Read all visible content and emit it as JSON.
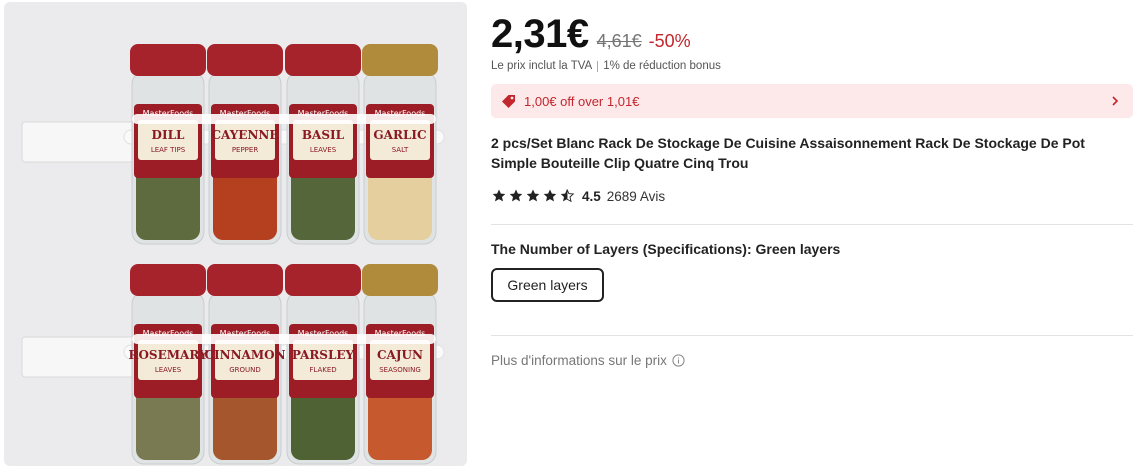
{
  "product_image": {
    "jars": [
      {
        "label_line1": "DILL",
        "label_line2": "LEAF TIPS",
        "cap": "#a6232c"
      },
      {
        "label_line1": "CAYENNE",
        "label_line2": "PEPPER",
        "cap": "#a6232c"
      },
      {
        "label_line1": "BASIL",
        "label_line2": "LEAVES",
        "cap": "#a6232c"
      },
      {
        "label_line1": "GARLIC",
        "label_line2": "SALT",
        "cap": "#b08b3c"
      },
      {
        "label_line1": "ROSEMARY",
        "label_line2": "LEAVES",
        "cap": "#a6232c"
      },
      {
        "label_line1": "CINNAMON",
        "label_line2": "GROUND",
        "cap": "#a6232c"
      },
      {
        "label_line1": "PARSLEY",
        "label_line2": "FLAKED",
        "cap": "#a6232c"
      },
      {
        "label_line1": "CAJUN",
        "label_line2": "SEASONING",
        "cap": "#b08b3c"
      }
    ],
    "brand": "MasterFoods"
  },
  "price": {
    "current": "2,31€",
    "original": "4,61€",
    "discount": "-50%"
  },
  "tax": {
    "included": "Le prix inclut la TVA",
    "bonus": "1% de réduction bonus"
  },
  "coupon": {
    "text": "1,00€ off over 1,01€",
    "icon": "tag-icon"
  },
  "product": {
    "title": "2 pcs/Set Blanc Rack De Stockage De Cuisine Assaisonnement Rack De Stockage De Pot Simple Bouteille Clip Quatre Cinq Trou"
  },
  "rating": {
    "value": "4.5",
    "stars": 4.5,
    "reviews": "2689 Avis"
  },
  "specs": {
    "label": "The Number of Layers (Specifications): Green layers",
    "selected_option": "Green layers"
  },
  "more_info": {
    "text": "Plus d'informations sur le prix"
  },
  "colors": {
    "accent_red": "#c1272d",
    "banner_bg": "#fde8ea"
  }
}
